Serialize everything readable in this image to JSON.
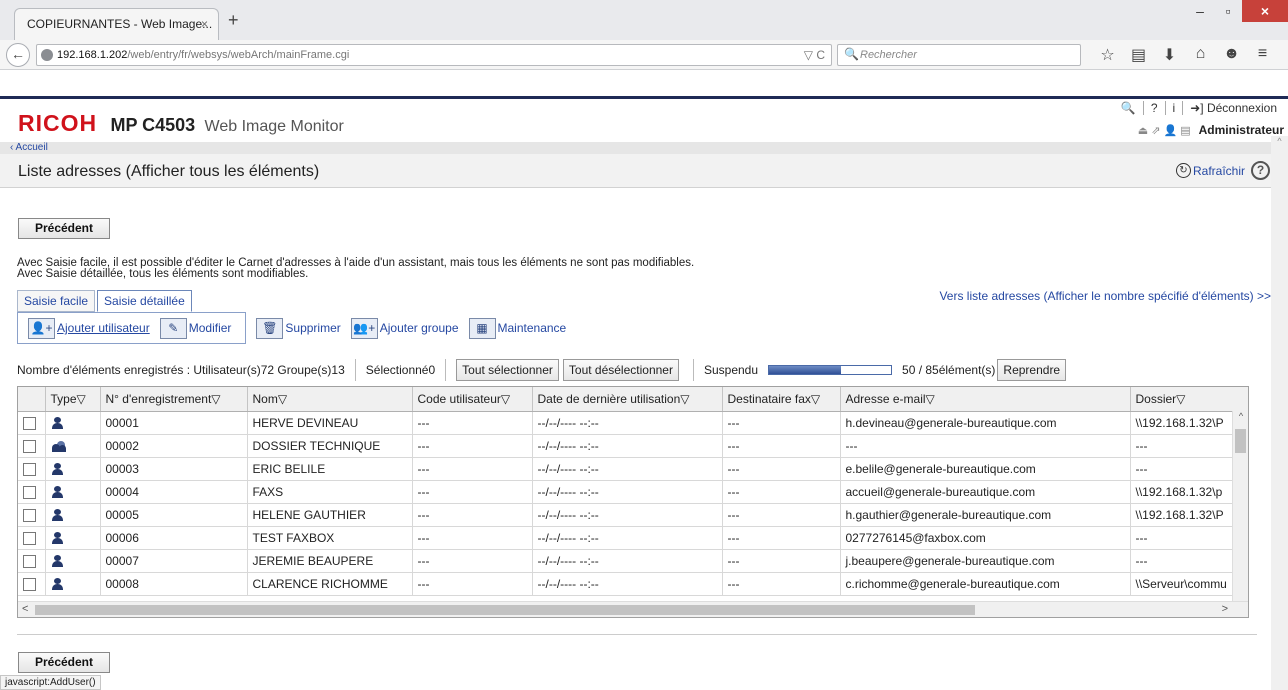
{
  "browser": {
    "tab_title": "COPIEURNANTES - Web Image...",
    "tab_close": "×",
    "new_tab": "+",
    "window_controls": [
      "–",
      "▫",
      "×"
    ],
    "url_host": "192.168.1.202",
    "url_path": "/web/entry/fr/websys/webArch/mainFrame.cgi",
    "url_right": "▽ C",
    "search_placeholder": "Rechercher"
  },
  "header": {
    "brand": "RICOH",
    "model": "MP C4503",
    "product": "Web Image Monitor",
    "top_links": [
      "🔍",
      "?",
      "i",
      "➜] Déconnexion"
    ],
    "admin_label": "Administrateur",
    "breadcrumb": "‹ Accueil"
  },
  "page": {
    "title": "Liste adresses (Afficher tous les éléments)",
    "refresh_label": "Rafraîchir",
    "prev_button": "Précédent",
    "description_1": "Avec Saisie facile, il est possible d'éditer le Carnet d'adresses à l'aide d'un assistant, mais tous les éléments ne sont pas modifiables.",
    "description_2": "Avec Saisie détaillée, tous les éléments sont modifiables.",
    "tab_easy": "Saisie facile",
    "tab_detailed": "Saisie détaillée",
    "to_list_link": "Vers liste adresses (Afficher le nombre spécifié d'éléments) >>"
  },
  "toolbar": {
    "add_user": "Ajouter utilisateur",
    "modify": "Modifier",
    "delete": "Supprimer",
    "add_group": "Ajouter groupe",
    "maintenance": "Maintenance"
  },
  "counts": {
    "registered": "Nombre d'éléments enregistrés : Utilisateur(s)72 Groupe(s)13",
    "selected": "Sélectionné0",
    "select_all": "Tout sélectionner",
    "deselect_all": "Tout désélectionner",
    "suspended": "Suspendu",
    "progress_fraction": 0.588,
    "progress_text": "50 / 85élément(s)",
    "resume": "Reprendre"
  },
  "table": {
    "columns": [
      "",
      "Type▽",
      "N° d'enregistrement▽",
      "Nom▽",
      "Code utilisateur▽",
      "Date de dernière utilisation▽",
      "Destinataire fax▽",
      "Adresse e-mail▽",
      "Dossier▽"
    ],
    "rows": [
      {
        "type": "user",
        "num": "00001",
        "name": "HERVE DEVINEAU",
        "code": "---",
        "date": "--/--/---- --:--",
        "fax": "---",
        "email": "h.devineau@generale-bureautique.com",
        "folder": "\\\\192.168.1.32\\P"
      },
      {
        "type": "group",
        "num": "00002",
        "name": "DOSSIER TECHNIQUE",
        "code": "---",
        "date": "--/--/---- --:--",
        "fax": "---",
        "email": "---",
        "folder": "---"
      },
      {
        "type": "user",
        "num": "00003",
        "name": "ERIC BELILE",
        "code": "---",
        "date": "--/--/---- --:--",
        "fax": "---",
        "email": "e.belile@generale-bureautique.com",
        "folder": "---"
      },
      {
        "type": "user",
        "num": "00004",
        "name": "FAXS",
        "code": "---",
        "date": "--/--/---- --:--",
        "fax": "---",
        "email": "accueil@generale-bureautique.com",
        "folder": "\\\\192.168.1.32\\p"
      },
      {
        "type": "user",
        "num": "00005",
        "name": "HELENE GAUTHIER",
        "code": "---",
        "date": "--/--/---- --:--",
        "fax": "---",
        "email": "h.gauthier@generale-bureautique.com",
        "folder": "\\\\192.168.1.32\\P"
      },
      {
        "type": "user",
        "num": "00006",
        "name": "TEST FAXBOX",
        "code": "---",
        "date": "--/--/---- --:--",
        "fax": "---",
        "email": "0277276145@faxbox.com",
        "folder": "---"
      },
      {
        "type": "user",
        "num": "00007",
        "name": "JEREMIE BEAUPERE",
        "code": "---",
        "date": "--/--/---- --:--",
        "fax": "---",
        "email": "j.beaupere@generale-bureautique.com",
        "folder": "---"
      },
      {
        "type": "user",
        "num": "00008",
        "name": "CLARENCE RICHOMME",
        "code": "---",
        "date": "--/--/---- --:--",
        "fax": "---",
        "email": "c.richomme@generale-bureautique.com",
        "folder": "\\\\Serveur\\commu"
      }
    ]
  },
  "status_bar": "javascript:AddUser()"
}
